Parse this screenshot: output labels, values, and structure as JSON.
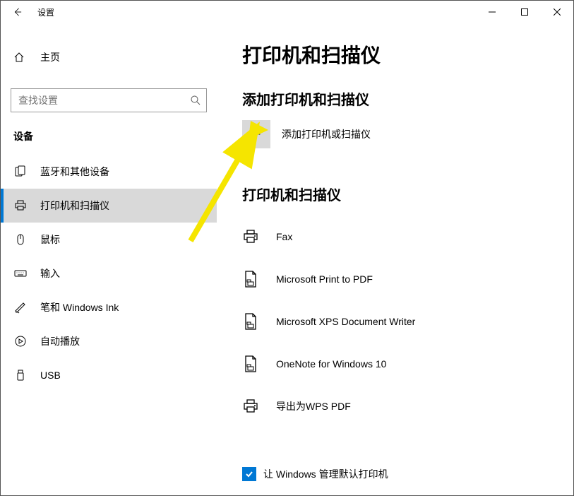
{
  "titlebar": {
    "title": "设置"
  },
  "sidebar": {
    "home_label": "主页",
    "search_placeholder": "查找设置",
    "category_label": "设备",
    "items": [
      {
        "label": "蓝牙和其他设备"
      },
      {
        "label": "打印机和扫描仪"
      },
      {
        "label": "鼠标"
      },
      {
        "label": "输入"
      },
      {
        "label": "笔和 Windows Ink"
      },
      {
        "label": "自动播放"
      },
      {
        "label": "USB"
      }
    ]
  },
  "main": {
    "page_title": "打印机和扫描仪",
    "add_section_title": "添加打印机和扫描仪",
    "add_button_label": "添加打印机或扫描仪",
    "list_section_title": "打印机和扫描仪",
    "printers": [
      {
        "name": "Fax"
      },
      {
        "name": "Microsoft Print to PDF"
      },
      {
        "name": "Microsoft XPS Document Writer"
      },
      {
        "name": "OneNote for Windows 10"
      },
      {
        "name": "导出为WPS PDF"
      }
    ],
    "checkbox_label": "让 Windows 管理默认打印机"
  }
}
